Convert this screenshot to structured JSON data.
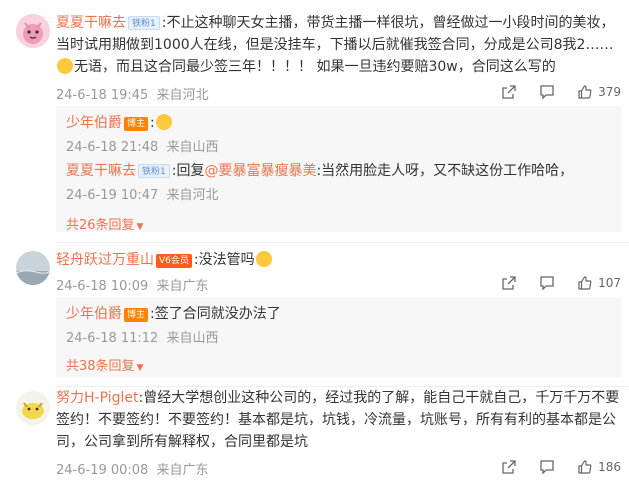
{
  "comments": [
    {
      "user": "夏夏干嘛去",
      "badge": "铁粉1",
      "text": ":不止这种聊天女主播，带货主播一样很坑，曾经做过一小段时间的美妆，当时试用期做到1000人在线，但是没挂车，下播以后就催我签合同，分成是公司8我2……",
      "text_tail": "无语，而且这合同最少签三年！！！！ 如果一旦违约要赔30w，合同这么写的",
      "date": "24-6-18 19:45",
      "location": "来自河北",
      "likes": "379",
      "replies": [
        {
          "user": "少年伯爵",
          "badge": "博主",
          "text": ":",
          "date": "24-6-18 21:48",
          "location": "来自山西"
        },
        {
          "user": "夏夏干嘛去",
          "badge": "铁粉1",
          "text_pre": ":回复",
          "mention": "@要暴富暴瘦暴美",
          "text": ":当然用脸走人呀，又不缺这份工作哈哈，",
          "date": "24-6-19 10:47",
          "location": "来自河北"
        }
      ],
      "more": "共26条回复"
    },
    {
      "user": "轻舟跃过万重山",
      "badge": "V6会员",
      "text": ":没法管吗",
      "date": "24-6-18 10:09",
      "location": "来自广东",
      "likes": "107",
      "replies": [
        {
          "user": "少年伯爵",
          "badge": "博主",
          "text": ":签了合同就没办法了",
          "date": "24-6-18 11:12",
          "location": "来自山西"
        }
      ],
      "more": "共38条回复"
    },
    {
      "user": "努力H-Piglet",
      "text": ":曾经大学想创业这种公司的，经过我的了解，能自己干就自己，千万千万不要签约！不要签约！不要签约！基本都是坑，坑钱，冷流量，坑账号，所有有利的基本都是公司，公司拿到所有解释权，合同里都是坑",
      "date": "24-6-19 00:08",
      "location": "来自广东",
      "likes": "186"
    }
  ],
  "icons": {
    "share": "share-icon",
    "comment": "comment-icon",
    "like": "thumbs-up-icon"
  },
  "colors": {
    "name": "#eb7350",
    "meta": "#999999",
    "reply_bg": "#f7f7f7"
  }
}
